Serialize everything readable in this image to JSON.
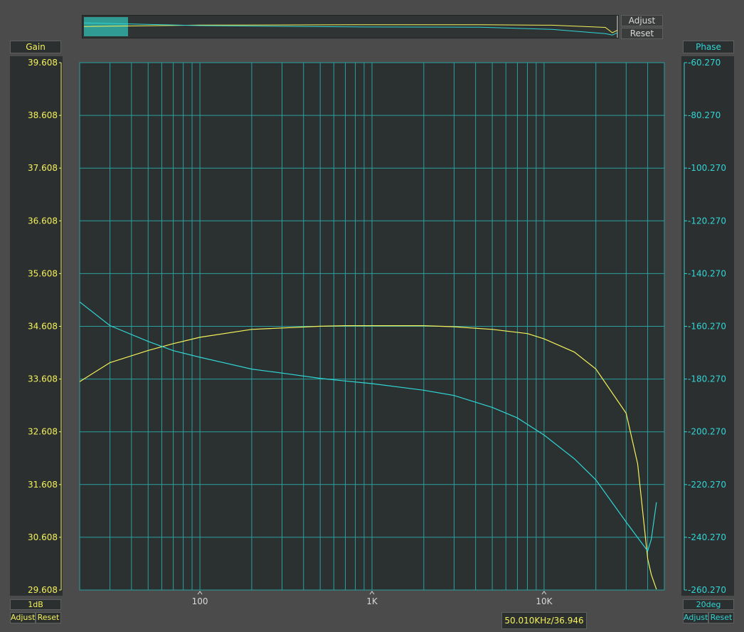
{
  "colors": {
    "gain": "#f4f25a",
    "phase": "#31d5d5",
    "grid": "#2b9f9f",
    "plot_bg": "#2b3030"
  },
  "overview": {
    "adjust_label": "Adjust",
    "reset_label": "Reset"
  },
  "left_axis": {
    "title": "Gain",
    "scale": "1dB",
    "adjust_label": "Adjust",
    "reset_label": "Reset"
  },
  "right_axis": {
    "title": "Phase",
    "scale": "20deg",
    "adjust_label": "Adjust",
    "reset_label": "Reset"
  },
  "readout": "50.010KHz/36.946",
  "chart_data": {
    "type": "line",
    "xscale": "log",
    "xlim": [
      20,
      50000
    ],
    "x_ticks": [
      {
        "value": 100,
        "label": "100"
      },
      {
        "value": 1000,
        "label": "1K"
      },
      {
        "value": 10000,
        "label": "10K"
      }
    ],
    "y_left": {
      "lim": [
        29.608,
        39.608
      ],
      "ticks": [
        "39.608",
        "38.608",
        "37.608",
        "36.608",
        "35.608",
        "34.608",
        "33.608",
        "32.608",
        "31.608",
        "30.608",
        "29.608"
      ]
    },
    "y_right": {
      "lim": [
        -260.27,
        -60.27
      ],
      "ticks": [
        "-60.270",
        "-80.270",
        "-100.270",
        "-120.270",
        "-140.270",
        "-160.270",
        "-180.270",
        "-200.270",
        "-220.270",
        "-240.270",
        "-260.270"
      ]
    },
    "grid": true,
    "series": [
      {
        "axis": "left",
        "color": "#f4f25a",
        "x": [
          20,
          30,
          50,
          70,
          100,
          200,
          500,
          700,
          1000,
          2000,
          3000,
          5000,
          8000,
          10000,
          15000,
          20000,
          30000,
          35000,
          40000,
          42000,
          45000
        ],
        "y": [
          33.56,
          33.92,
          34.15,
          34.28,
          34.4,
          34.55,
          34.61,
          34.62,
          34.62,
          34.62,
          34.6,
          34.55,
          34.47,
          34.37,
          34.12,
          33.8,
          32.96,
          32.0,
          30.2,
          29.9,
          29.62
        ]
      },
      {
        "axis": "right",
        "color": "#31d5d5",
        "x": [
          20,
          30,
          50,
          70,
          100,
          200,
          300,
          500,
          700,
          1000,
          2000,
          3000,
          5000,
          7000,
          10000,
          15000,
          20000,
          30000,
          40000,
          42000,
          45000
        ],
        "y": [
          -151.0,
          -160.0,
          -166.0,
          -169.5,
          -172.0,
          -176.5,
          -178.0,
          -180.0,
          -181.0,
          -182.0,
          -184.5,
          -186.5,
          -191.0,
          -195.0,
          -201.5,
          -210.5,
          -218.5,
          -234.5,
          -245.5,
          -241.0,
          -227.0
        ]
      }
    ]
  },
  "overview_series": {
    "gain_y": [
      33.56,
      34.4,
      34.62,
      34.62,
      34.37,
      32.96,
      29.62,
      31.2
    ],
    "phase_y": [
      -151.0,
      -172.0,
      -182.0,
      -184.5,
      -201.5,
      -234.5,
      -245.5,
      -227.0
    ]
  }
}
